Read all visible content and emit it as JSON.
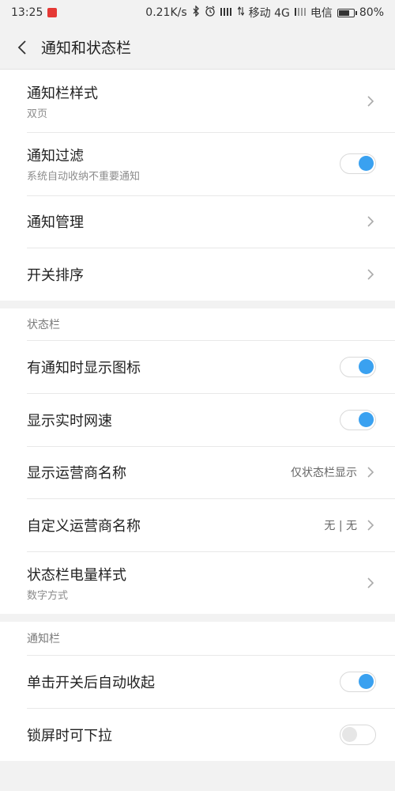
{
  "status_bar": {
    "time": "13:25",
    "speed": "0.21K/s",
    "carrier1": "移动 4G",
    "carrier2": "电信",
    "battery": "80%",
    "battery_level": 0.8
  },
  "header": {
    "title": "通知和状态栏"
  },
  "group1": {
    "notif_style": {
      "title": "通知栏样式",
      "sub": "双页"
    },
    "notif_filter": {
      "title": "通知过滤",
      "sub": "系统自动收纳不重要通知",
      "on": true
    },
    "notif_manage": {
      "title": "通知管理"
    },
    "switch_order": {
      "title": "开关排序"
    }
  },
  "status_section": {
    "label": "状态栏",
    "show_icon": {
      "title": "有通知时显示图标",
      "on": true
    },
    "show_speed": {
      "title": "显示实时网速",
      "on": true
    },
    "carrier_name": {
      "title": "显示运营商名称",
      "value": "仅状态栏显示"
    },
    "custom_carrier": {
      "title": "自定义运营商名称",
      "value": "无 | 无"
    },
    "battery_style": {
      "title": "状态栏电量样式",
      "sub": "数字方式"
    }
  },
  "notif_section": {
    "label": "通知栏",
    "auto_collapse": {
      "title": "单击开关后自动收起",
      "on": true
    },
    "lockscreen_pull": {
      "title": "锁屏时可下拉",
      "on": false
    }
  }
}
